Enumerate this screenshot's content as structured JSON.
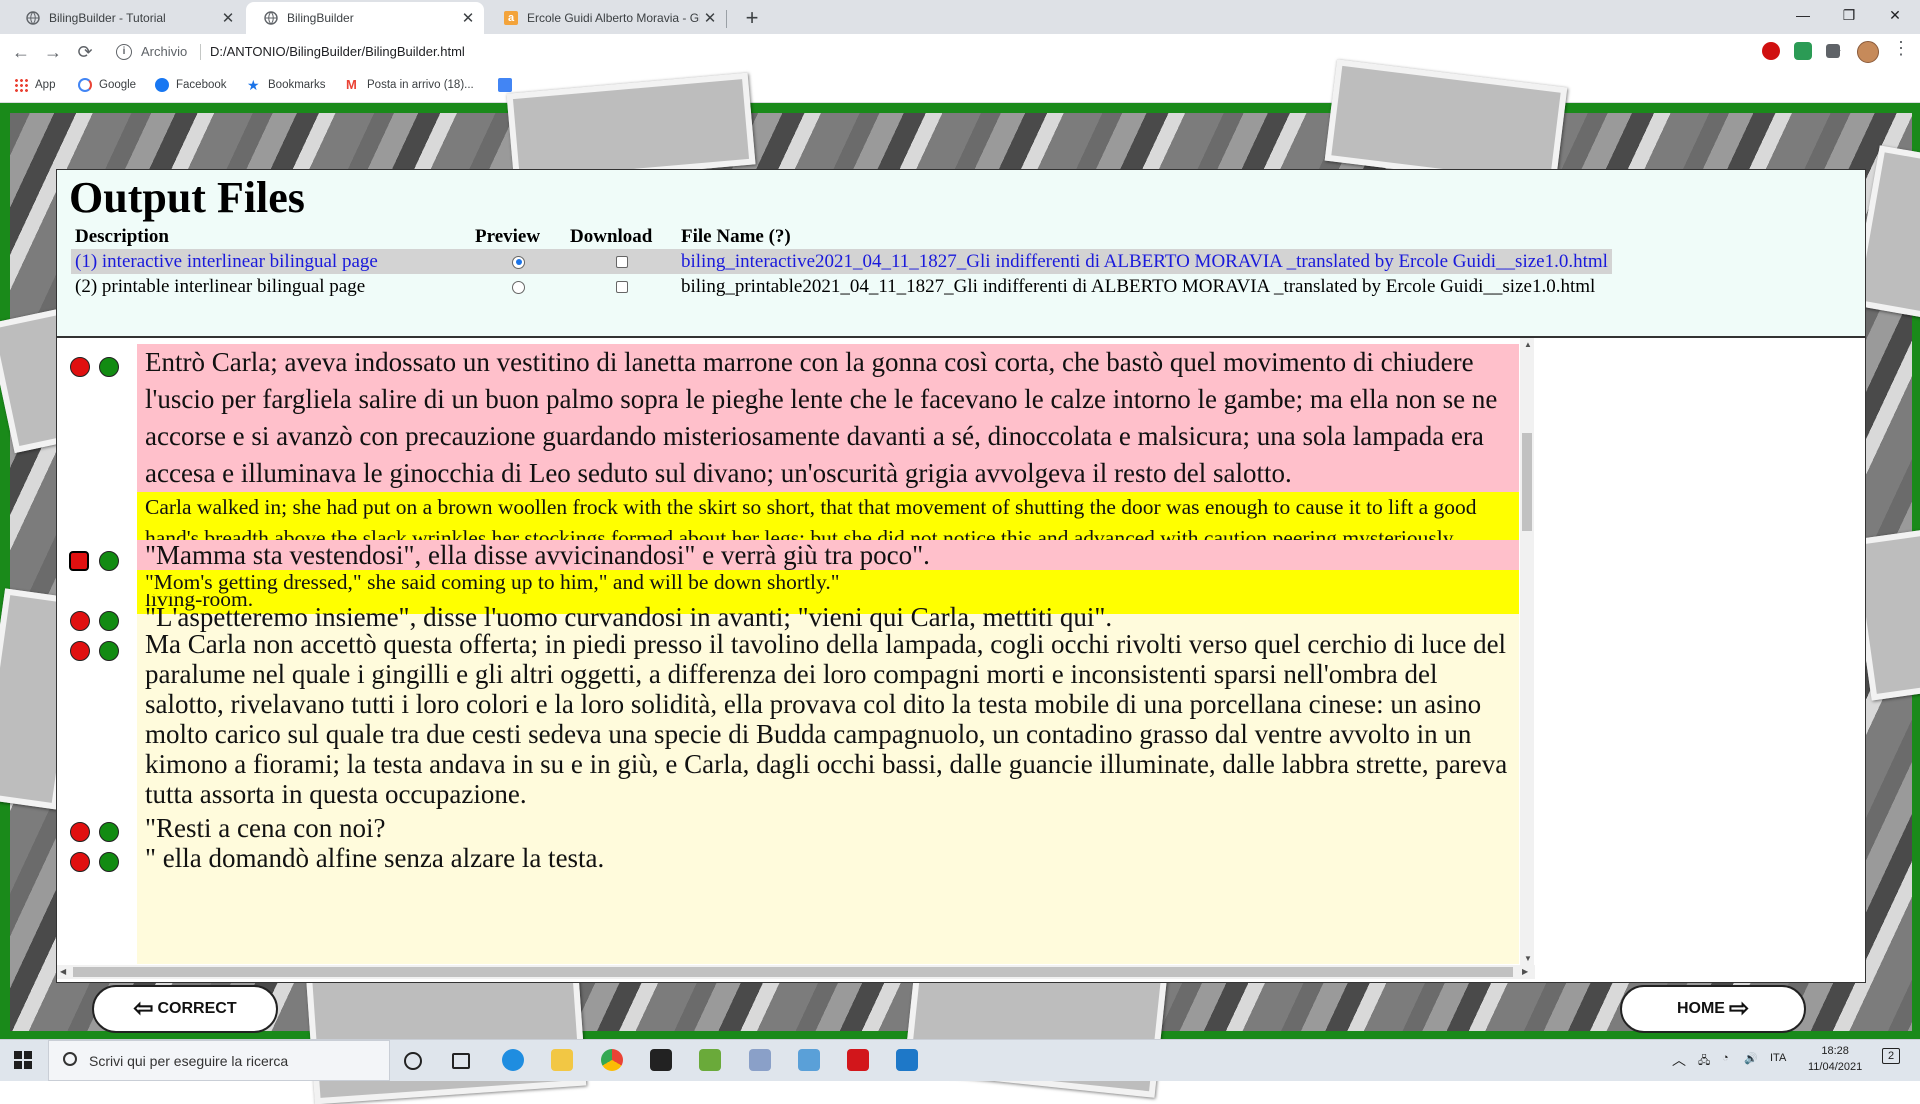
{
  "browser": {
    "tabs": [
      {
        "title": "BilingBuilder - Tutorial"
      },
      {
        "title": "BilingBuilder"
      },
      {
        "title": "Ercole Guidi Alberto Moravia - Gli indifferenti"
      }
    ],
    "new_tab": "+",
    "address_scheme": "Archivio",
    "address_url": "D:/ANTONIO/BilingBuilder/BilingBuilder.html",
    "bookmarks": [
      "App",
      "Google",
      "Facebook",
      "Bookmarks",
      "Posta in arrivo (18)..."
    ]
  },
  "output": {
    "title": "Output Files",
    "headers": {
      "description": "Description",
      "preview": "Preview",
      "download": "Download",
      "file_name": "File Name (?)"
    },
    "rows": [
      {
        "description": "(1) interactive interlinear bilingual page",
        "preview": true,
        "download": false,
        "file": "biling_interactive2021_04_11_1827_Gli indifferenti di ALBERTO MORAVIA _translated by Ercole Guidi__size1.0.html"
      },
      {
        "description": "(2) printable interlinear bilingual page",
        "preview": false,
        "download": false,
        "file": "biling_printable2021_04_11_1827_Gli indifferenti di ALBERTO MORAVIA _translated by Ercole Guidi__size1.0.html"
      }
    ]
  },
  "text": {
    "s1_it": "Entrò Carla; aveva indossato un vestitino di lanetta marrone con la gonna così corta, che bastò quel movimento di chiudere l'uscio per fargliela salire di un buon palmo sopra le pieghe lente che le facevano le calze intorno le gambe; ma ella non se ne accorse e si avanzò con precauzione guardando misteriosamente davanti a sé, dinoccolata e malsicura; una sola lampada era accesa e illuminava le ginocchia di Leo seduto sul divano; un'oscurità grigia avvolgeva il resto del salotto.",
    "s1_en": "Carla walked in; she had put on a brown woollen frock with the skirt so short, that that movement of shutting the door was enough to cause it to lift a good hand's breadth above the slack wrinkles her stockings formed about her legs; but she did not notice this and advanced with caution peering mysteriously before her, slouching and unsteady; only one lamp was burning and was illuminating Leo's knees as he sat on the sofa; a grey gloom swathed the rest of the living-room.",
    "s2_it": "\"Mamma sta vestendosi\", ella disse avvicinandosi\" e verrà giù tra poco\".",
    "s2_en": "\"Mom's getting dressed,\" she said coming up to him,\" and will be down shortly.\"",
    "s3_it": "\"L'aspetteremo insieme\", disse l'uomo curvandosi in avanti; \"vieni qui Carla, mettiti qui\".",
    "s4_it": "Ma Carla non accettò questa offerta; in piedi presso il tavolino della lampada, cogli occhi rivolti verso quel cerchio di luce del paralume nel quale i gingilli e gli altri oggetti, a differenza dei loro compagni morti e inconsistenti sparsi nell'ombra del salotto, rivelavano tutti i loro colori e la loro solidità, ella provava col dito la testa mobile di una porcellana cinese: un asino molto carico sul quale tra due cesti sedeva una specie di Budda campagnuolo, un contadino grasso dal ventre avvolto in un kimono a fiorami; la testa andava in su e in giù, e Carla, dagli occhi bassi, dalle guancie illuminate, dalle labbra strette, pareva tutta assorta in questa occupazione.",
    "s5_it": "\"Resti a cena con noi?",
    "s6_it": "\" ella domandò alfine senza alzare la testa."
  },
  "buttons": {
    "correct": "CORRECT",
    "home": "HOME"
  },
  "taskbar": {
    "search_placeholder": "Scrivi qui per eseguire la ricerca",
    "lang": "ITA",
    "time": "18:28",
    "date": "11/04/2021",
    "notifications": "2"
  },
  "colors": {
    "page_green": "#1a8a1a",
    "italian_bg": "#ffc0cb",
    "english_bg": "#ffff00",
    "text_bg": "#fffbdc",
    "selected_link": "#1a1adb"
  },
  "icons": {
    "correct": "arrow-left-outline-icon",
    "home": "arrow-right-outline-icon",
    "bullet_red": "red-dot-icon",
    "bullet_green": "green-dot-icon"
  }
}
